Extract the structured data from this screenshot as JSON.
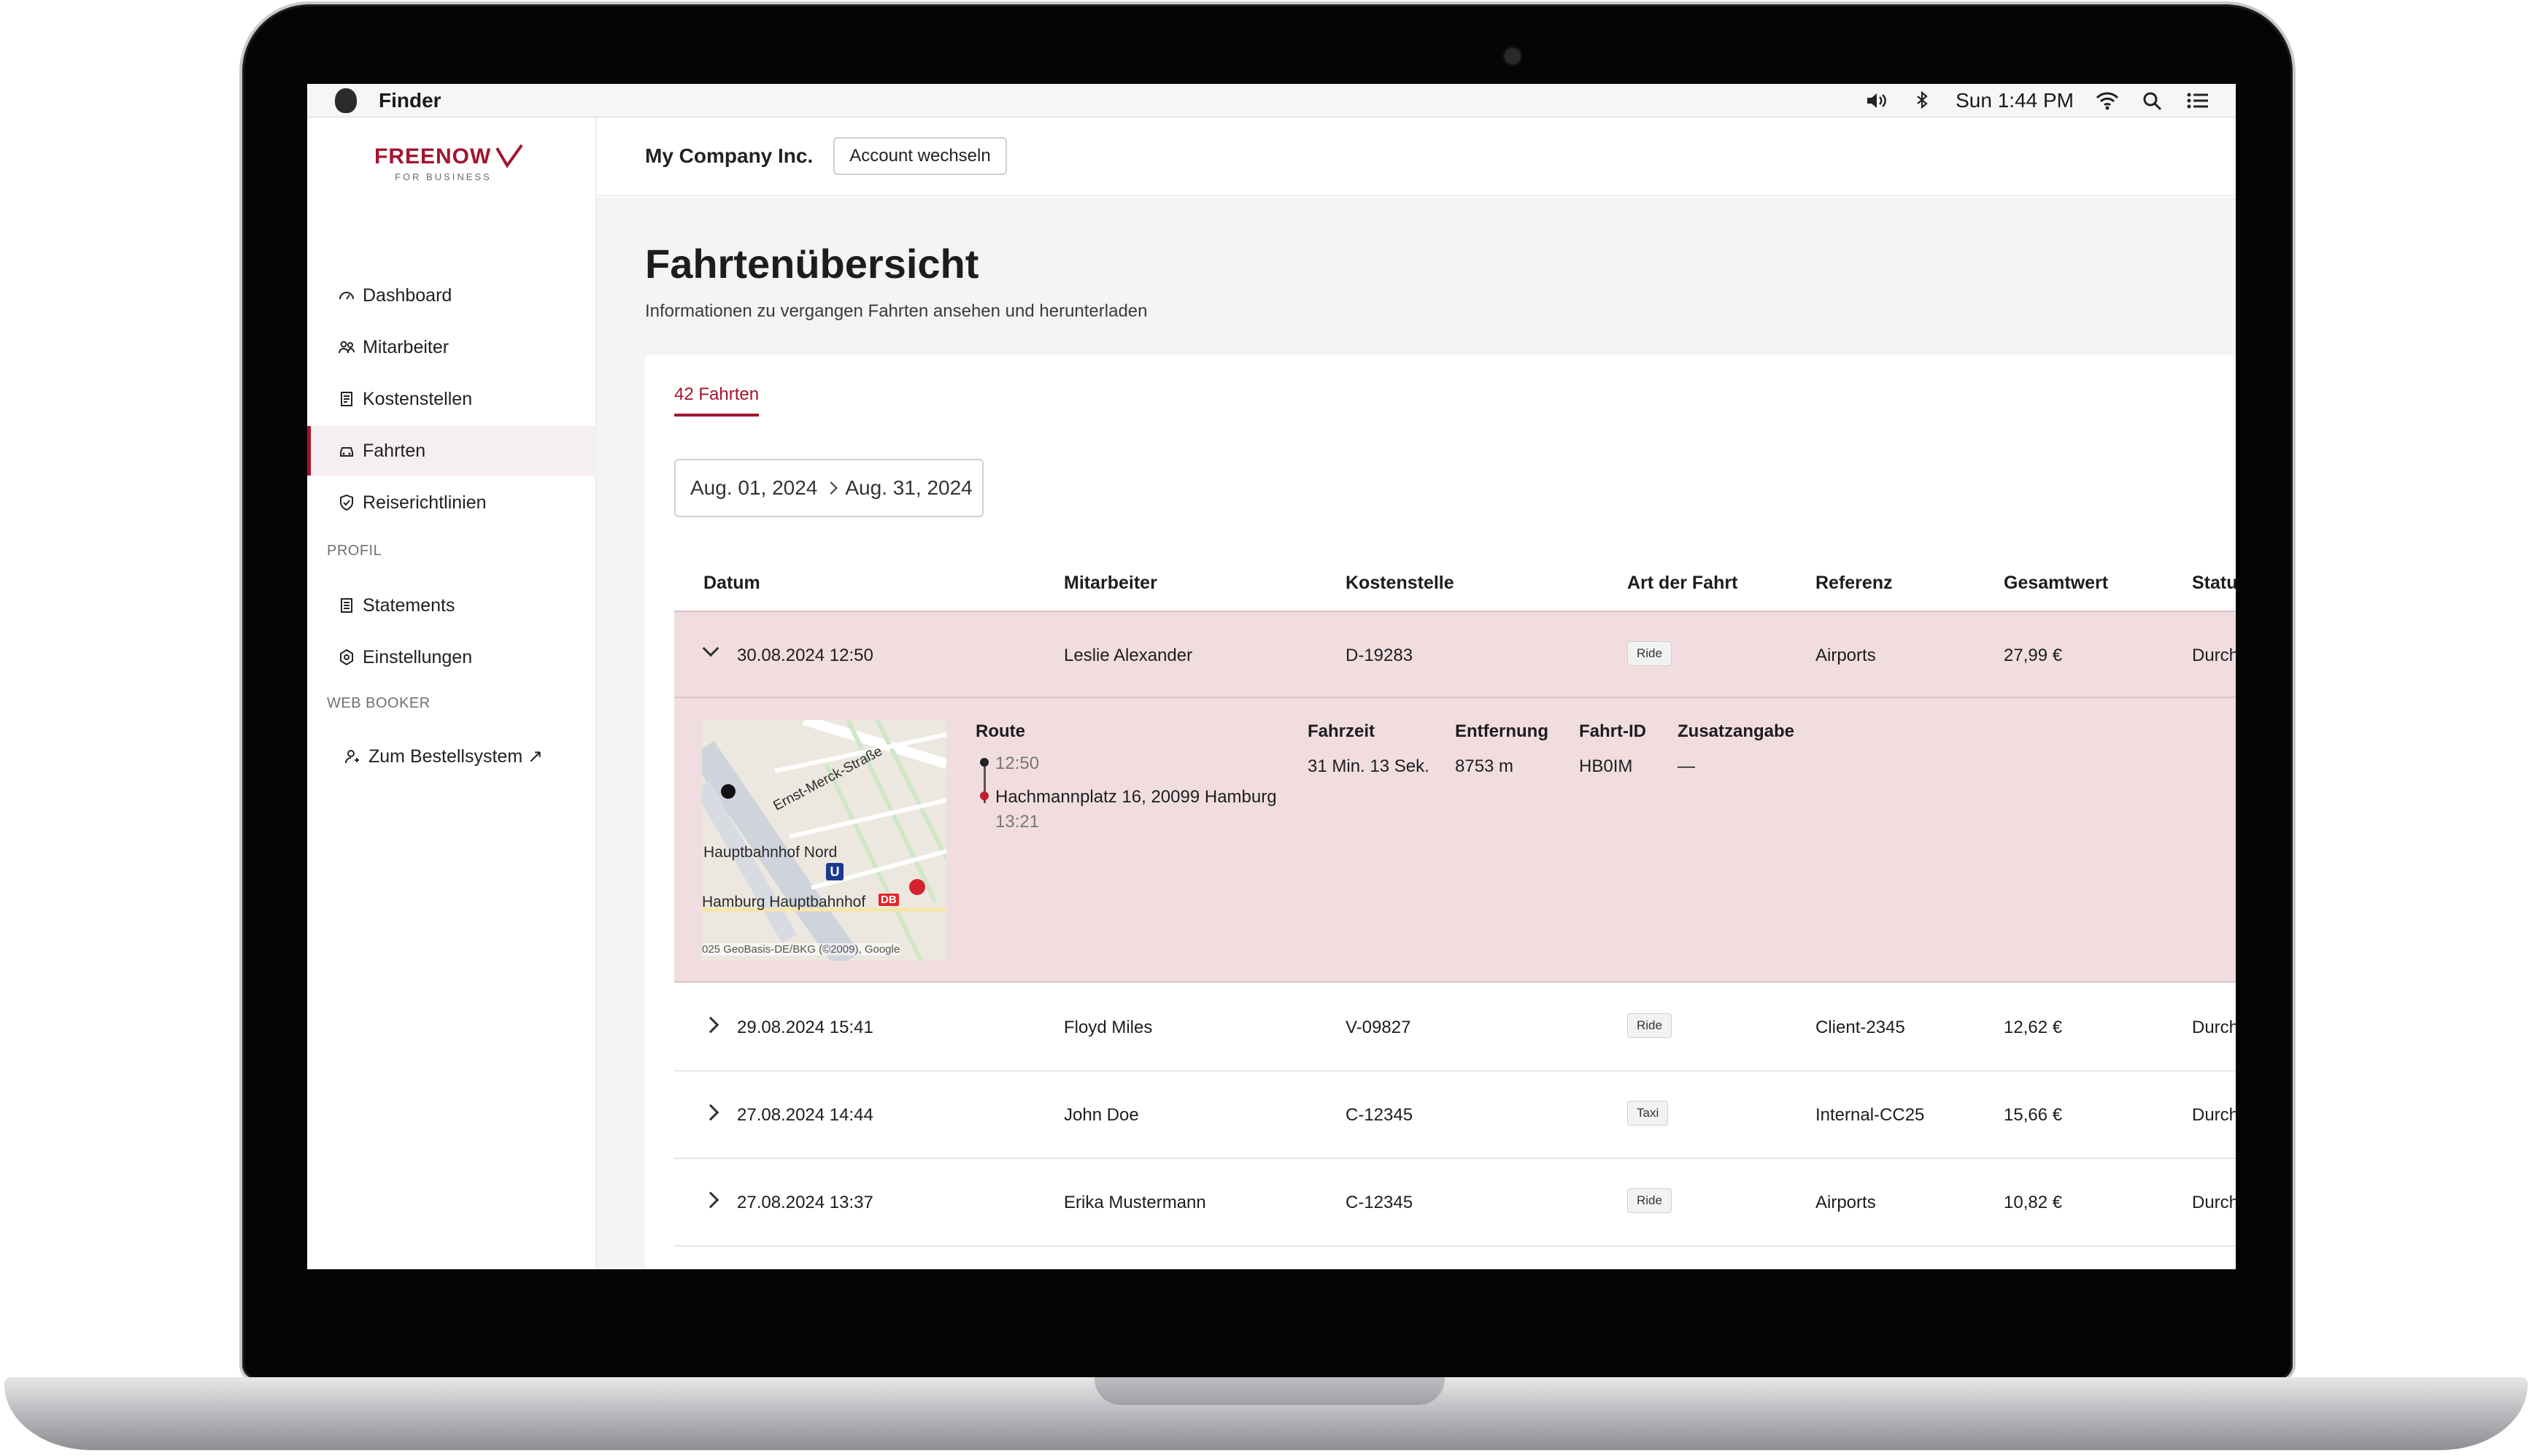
{
  "menubar": {
    "app": "Finder",
    "clock": "Sun 1:44 PM"
  },
  "brand": {
    "name": "FREENOW",
    "sub": "FOR BUSINESS"
  },
  "sidebar": {
    "items": [
      {
        "label": "Dashboard"
      },
      {
        "label": "Mitarbeiter"
      },
      {
        "label": "Kostenstellen"
      },
      {
        "label": "Fahrten"
      },
      {
        "label": "Reiserichtlinien"
      }
    ],
    "profile_heading": "PROFIL",
    "profile_items": [
      {
        "label": "Statements"
      },
      {
        "label": "Einstellungen"
      }
    ],
    "webbooker_heading": "WEB BOOKER",
    "webbooker_item": "Zum Bestellsystem ↗"
  },
  "topbar": {
    "company": "My Company Inc.",
    "switch_label": "Account wechseln"
  },
  "page": {
    "title": "Fahrtenübersicht",
    "subtitle": "Informationen zu vergangen Fahrten ansehen und herunterladen",
    "tab": "42 Fahrten",
    "date_from": "Aug. 01, 2024",
    "date_to": "Aug. 31, 2024"
  },
  "table": {
    "headers": [
      "Datum",
      "Mitarbeiter",
      "Kostenstelle",
      "Art der Fahrt",
      "Referenz",
      "Gesamtwert",
      "Statu"
    ],
    "rows": [
      {
        "date": "30.08.2024 12:50",
        "employee": "Leslie Alexander",
        "cost_center": "D-19283",
        "type": "Ride",
        "reference": "Airports",
        "total": "27,99 €",
        "status": "Durch"
      },
      {
        "date": "29.08.2024 15:41",
        "employee": "Floyd Miles",
        "cost_center": "V-09827",
        "type": "Ride",
        "reference": "Client-2345",
        "total": "12,62 €",
        "status": "Durch"
      },
      {
        "date": "27.08.2024 14:44",
        "employee": "John Doe",
        "cost_center": "C-12345",
        "type": "Taxi",
        "reference": "Internal-CC25",
        "total": "15,66 €",
        "status": "Durch"
      },
      {
        "date": "27.08.2024 13:37",
        "employee": "Erika Mustermann",
        "cost_center": "C-12345",
        "type": "Ride",
        "reference": "Airports",
        "total": "10,82 €",
        "status": "Durch"
      }
    ]
  },
  "details": {
    "headers": {
      "route": "Route",
      "duration": "Fahrzeit",
      "distance": "Entfernung",
      "ride_id": "Fahrt-ID",
      "extra": "Zusatzangabe"
    },
    "start_time": "12:50",
    "end_address": "Hachmannplatz 16, 20099 Hamburg",
    "end_time": "13:21",
    "duration": "31 Min. 13 Sek.",
    "distance": "8753 m",
    "ride_id": "HB0IM",
    "extra": "—",
    "map_labels": {
      "street": "Ernst-Merck-Straße",
      "station_north": "Hauptbahnhof Nord",
      "station_main": "Hamburg Hauptbahnhof",
      "u_badge": "U",
      "db_badge": "DB",
      "attribution": "025 GeoBasis-DE/BKG (©2009), Google"
    }
  },
  "colors": {
    "brand_red": "#a3152e",
    "expanded_bg": "#f1dde0"
  }
}
